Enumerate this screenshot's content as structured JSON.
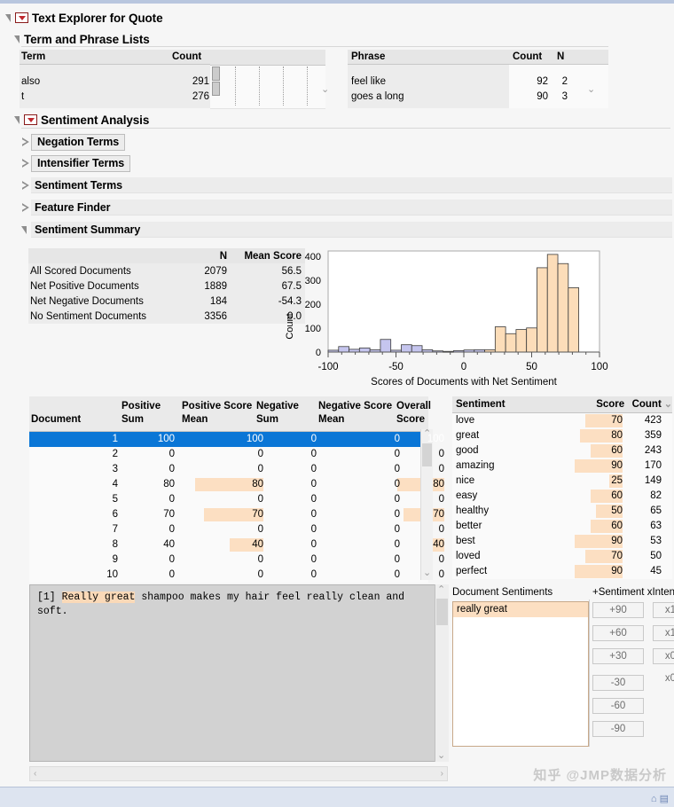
{
  "window": {
    "title": "Text Explorer for Quote"
  },
  "term_phrase": {
    "title": "Term and Phrase Lists",
    "term_table": {
      "columns": [
        "Term",
        "Count"
      ],
      "rows": [
        {
          "term": "also",
          "count": "291"
        },
        {
          "term": "t",
          "count": "276"
        }
      ]
    },
    "phrase_table": {
      "columns": [
        "Phrase",
        "Count",
        "N"
      ],
      "rows": [
        {
          "phrase": "feel like",
          "count": "92",
          "n": "2"
        },
        {
          "phrase": "goes a long",
          "count": "90",
          "n": "3"
        }
      ]
    }
  },
  "sentiment_analysis": {
    "title": "Sentiment Analysis",
    "sections": [
      {
        "label": "Negation Terms",
        "open": false,
        "boxed": true
      },
      {
        "label": "Intensifier Terms",
        "open": false,
        "boxed": true
      },
      {
        "label": "Sentiment Terms",
        "open": false,
        "boxed": false
      },
      {
        "label": "Feature Finder",
        "open": false,
        "boxed": false
      },
      {
        "label": "Sentiment Summary",
        "open": true,
        "boxed": false
      }
    ]
  },
  "summary_table": {
    "columns": [
      "",
      "N",
      "Mean Score"
    ],
    "rows": [
      {
        "label": "All Scored Documents",
        "n": "2079",
        "mean": "56.5"
      },
      {
        "label": "Net Positive Documents",
        "n": "1889",
        "mean": "67.5"
      },
      {
        "label": "Net Negative Documents",
        "n": "184",
        "mean": "-54.3"
      },
      {
        "label": "No Sentiment Documents",
        "n": "3356",
        "mean": "0.0"
      }
    ]
  },
  "chart_data": {
    "type": "bar",
    "title": "",
    "xlabel": "Scores of Documents with Net Sentiment",
    "ylabel": "Count",
    "xlim": [
      -100,
      100
    ],
    "ylim": [
      0,
      440
    ],
    "xticks": [
      -100,
      -50,
      0,
      50,
      100
    ],
    "yticks": [
      0,
      100,
      200,
      300,
      400
    ],
    "grid": false,
    "bin_width": 7.7,
    "negative_color": "#c5c5ee",
    "positive_color": "#fcddb9",
    "bin_starts": [
      -100,
      -92.3,
      -84.6,
      -76.9,
      -69.2,
      -61.5,
      -53.8,
      -46.1,
      -38.4,
      -30.7,
      -23,
      -15.3,
      -7.6,
      0,
      7.7,
      15.4,
      23.1,
      30.8,
      38.5,
      46.2,
      53.9,
      61.6,
      69.3,
      77,
      84.7,
      92.4
    ],
    "values": [
      8,
      24,
      12,
      18,
      10,
      55,
      8,
      32,
      28,
      10,
      5,
      3,
      6,
      9,
      10,
      10,
      110,
      80,
      98,
      105,
      367,
      425,
      385,
      280
    ],
    "categories": [
      "-100",
      "-92",
      "-85",
      "-77",
      "-69",
      "-62",
      "-54",
      "-46",
      "-38",
      "-31",
      "-23",
      "-15",
      "-8",
      "0",
      "8",
      "15",
      "23",
      "31",
      "38",
      "46",
      "54",
      "62",
      "69",
      "77"
    ]
  },
  "document_table": {
    "columns": [
      "Document",
      "Positive Sum",
      "Positive Score Mean",
      "Negative Sum",
      "Negative Score Mean",
      "Overall Score"
    ],
    "rows": [
      {
        "doc": "1",
        "pos_sum": "100",
        "pos_mean": "100",
        "neg_sum": "0",
        "neg_mean": "0",
        "overall": "100",
        "selected": true
      },
      {
        "doc": "2",
        "pos_sum": "0",
        "pos_mean": "0",
        "neg_sum": "0",
        "neg_mean": "0",
        "overall": "0",
        "selected": false
      },
      {
        "doc": "3",
        "pos_sum": "0",
        "pos_mean": "0",
        "neg_sum": "0",
        "neg_mean": "0",
        "overall": "0",
        "selected": false
      },
      {
        "doc": "4",
        "pos_sum": "80",
        "pos_mean": "80",
        "neg_sum": "0",
        "neg_mean": "0",
        "overall": "80",
        "selected": false
      },
      {
        "doc": "5",
        "pos_sum": "0",
        "pos_mean": "0",
        "neg_sum": "0",
        "neg_mean": "0",
        "overall": "0",
        "selected": false
      },
      {
        "doc": "6",
        "pos_sum": "70",
        "pos_mean": "70",
        "neg_sum": "0",
        "neg_mean": "0",
        "overall": "70",
        "selected": false
      },
      {
        "doc": "7",
        "pos_sum": "0",
        "pos_mean": "0",
        "neg_sum": "0",
        "neg_mean": "0",
        "overall": "0",
        "selected": false
      },
      {
        "doc": "8",
        "pos_sum": "40",
        "pos_mean": "40",
        "neg_sum": "0",
        "neg_mean": "0",
        "overall": "40",
        "selected": false
      },
      {
        "doc": "9",
        "pos_sum": "0",
        "pos_mean": "0",
        "neg_sum": "0",
        "neg_mean": "0",
        "overall": "0",
        "selected": false
      },
      {
        "doc": "10",
        "pos_sum": "0",
        "pos_mean": "0",
        "neg_sum": "0",
        "neg_mean": "0",
        "overall": "0",
        "selected": false
      }
    ]
  },
  "sentiment_table": {
    "columns": [
      "Sentiment",
      "Score",
      "Count"
    ],
    "rows": [
      {
        "term": "love",
        "score": "70",
        "count": "423"
      },
      {
        "term": "great",
        "score": "80",
        "count": "359"
      },
      {
        "term": "good",
        "score": "60",
        "count": "243"
      },
      {
        "term": "amazing",
        "score": "90",
        "count": "170"
      },
      {
        "term": "nice",
        "score": "25",
        "count": "149"
      },
      {
        "term": "easy",
        "score": "60",
        "count": "82"
      },
      {
        "term": "healthy",
        "score": "50",
        "count": "65"
      },
      {
        "term": "better",
        "score": "60",
        "count": "63"
      },
      {
        "term": "best",
        "score": "90",
        "count": "53"
      },
      {
        "term": "loved",
        "score": "70",
        "count": "50"
      },
      {
        "term": "perfect",
        "score": "90",
        "count": "45"
      }
    ]
  },
  "document_text": {
    "prefix": "[1] ",
    "highlight": "Really great",
    "rest": " shampoo makes my hair feel really clean and soft."
  },
  "document_sentiments": {
    "title": "Document Sentiments",
    "items": [
      "really great"
    ]
  },
  "intensifier_panel": {
    "title": "+Sentiment xIntensifier",
    "score_buttons": [
      "+90",
      "+60",
      "+30",
      "-30",
      "-60",
      "-90"
    ],
    "multiplier_buttons": [
      "x1",
      "x1",
      "x0",
      "x0"
    ]
  },
  "watermark": {
    "text": "知乎 @JMP数据分析"
  },
  "colors": {
    "selection_blue": "#0a76d6",
    "highlight_orange": "#fcdfc2",
    "hist_positive": "#fcddb9",
    "hist_negative": "#c5c5ee"
  }
}
